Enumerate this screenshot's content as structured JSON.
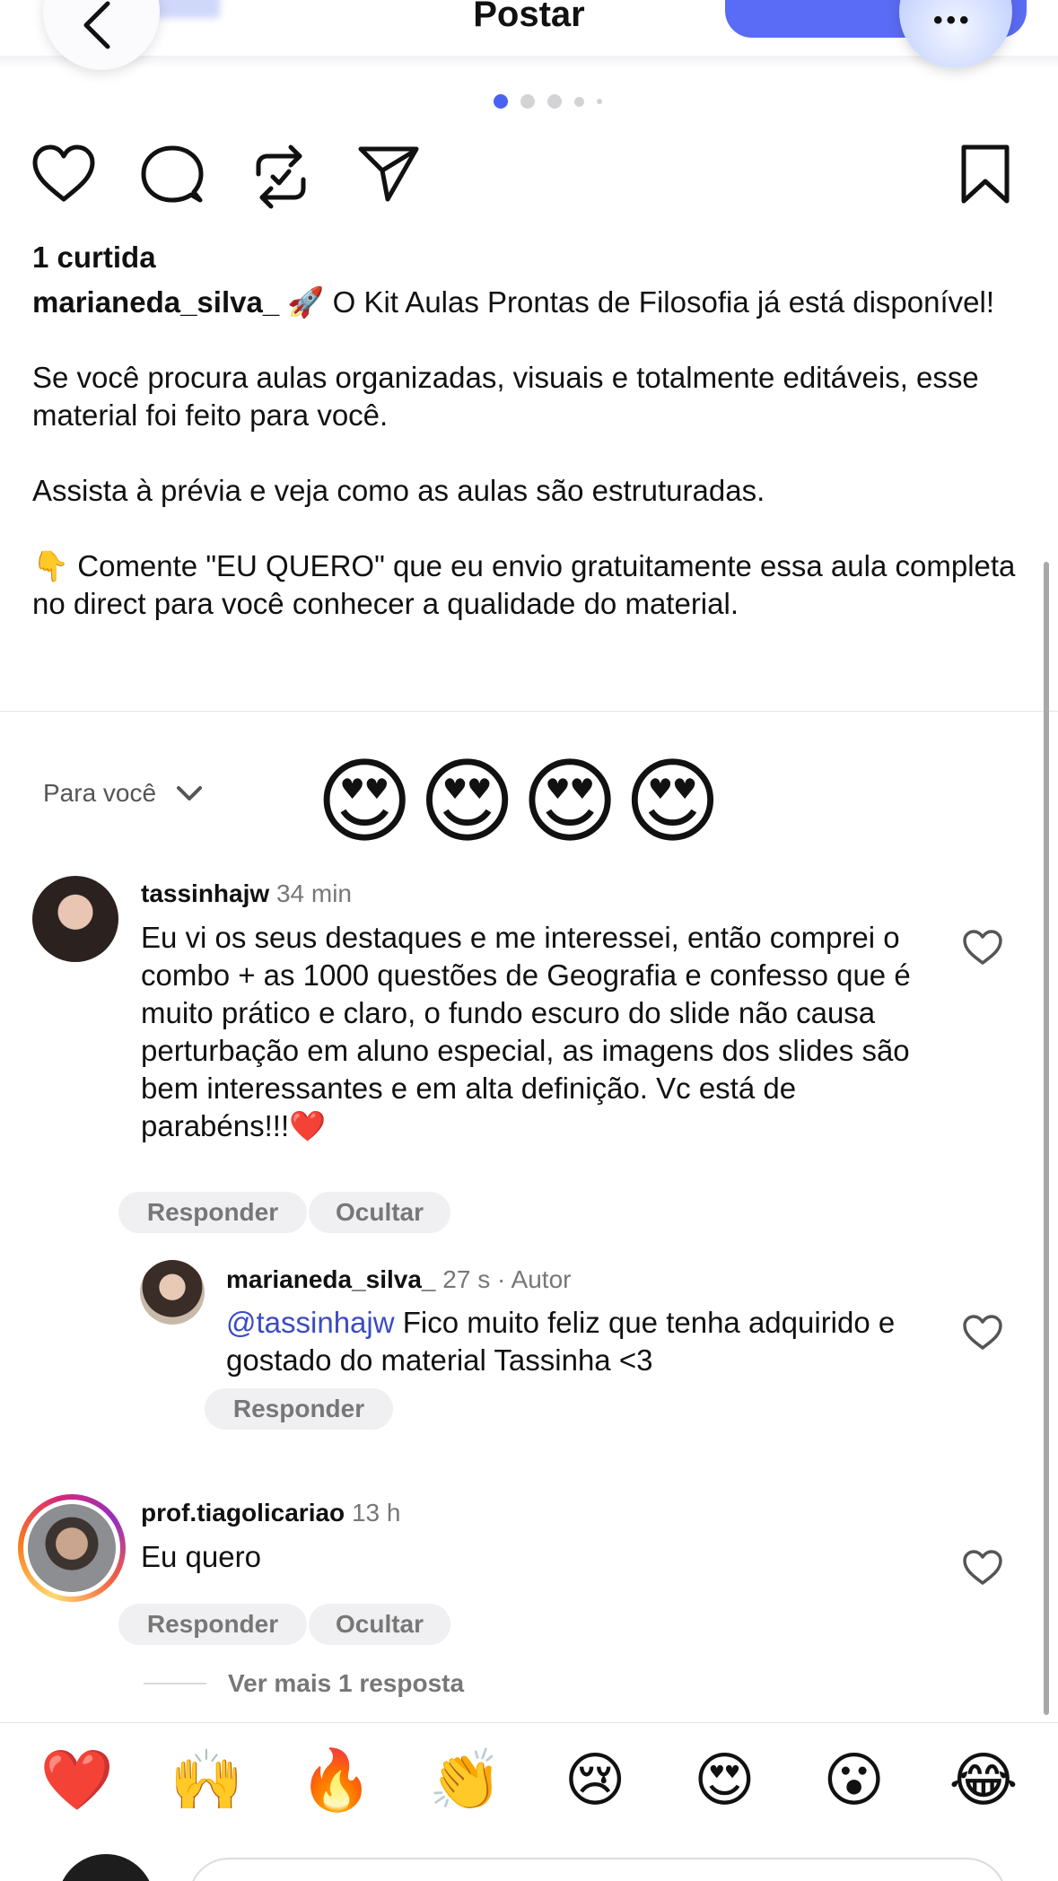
{
  "header": {
    "title": "Postar"
  },
  "carousel": {
    "count": 5,
    "active_index": 0
  },
  "actions": {
    "icons": [
      "heart-icon",
      "comment-icon",
      "repost-icon",
      "share-icon",
      "bookmark-icon"
    ]
  },
  "post": {
    "likes": "1 curtida",
    "username": "marianeda_silva_",
    "paragraphs": [
      "🚀 O Kit Aulas Prontas de Filosofia já está disponível!",
      "Se você procura aulas organizadas, visuais e totalmente editáveis, esse material foi feito para você.",
      "Assista à prévia e veja como as aulas são estruturadas.",
      "👇 Comente \"EU QUERO\" que eu envio gratuitamente essa aula completa no direct para você conhecer a qualidade do material."
    ]
  },
  "sort": {
    "label": "Para você"
  },
  "overlay_emojis": "😍😍😍😍",
  "comments": [
    {
      "username": "tassinhajw",
      "time": "34 min",
      "text": "Eu vi os seus destaques e me interessei, então comprei o combo + as 1000 questões de Geografia e confesso que é  muito prático e claro, o fundo escuro do slide não causa perturbação em aluno especial, as imagens dos slides são bem interessantes e em alta definição. Vc está de parabéns!!!❤️",
      "reply_label": "Responder",
      "hide_label": "Ocultar",
      "reply": {
        "username": "marianeda_silva_",
        "time": "27 s",
        "author_tag": "· Autor",
        "mention": "@tassinhajw",
        "text": " Fico muito feliz que tenha adquirido e gostado do material Tassinha <3",
        "reply_label": "Responder"
      }
    },
    {
      "username": "prof.tiagolicariao",
      "time": "13 h",
      "text": "Eu quero",
      "reply_label": "Responder",
      "hide_label": "Ocultar",
      "more_replies": "Ver mais 1 resposta"
    }
  ],
  "quick_reactions": [
    "❤️",
    "🙌",
    "🔥",
    "👏",
    "😢",
    "😍",
    "😮",
    "😂"
  ],
  "colors": {
    "accent": "#4a62f2",
    "mention": "#3b4cc0",
    "muted": "#777777"
  }
}
